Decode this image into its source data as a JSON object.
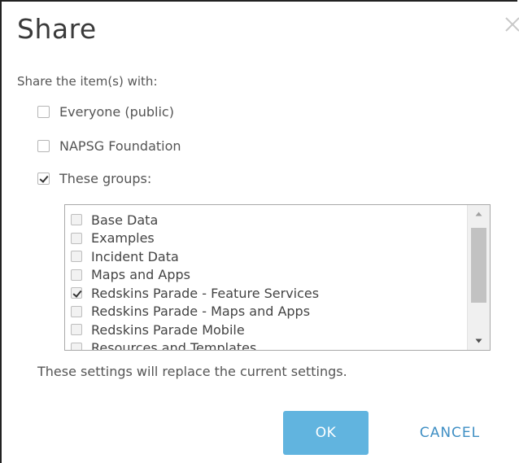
{
  "dialog": {
    "title": "Share",
    "prompt": "Share the item(s) with:",
    "options": [
      {
        "label": "Everyone (public)",
        "checked": false
      },
      {
        "label": "NAPSG Foundation",
        "checked": false
      },
      {
        "label": "These groups:",
        "checked": true
      }
    ],
    "groups": [
      {
        "label": "Base Data",
        "checked": false
      },
      {
        "label": "Examples",
        "checked": false
      },
      {
        "label": "Incident Data",
        "checked": false
      },
      {
        "label": "Maps and Apps",
        "checked": false
      },
      {
        "label": "Redskins Parade - Feature Services",
        "checked": true
      },
      {
        "label": "Redskins Parade - Maps and Apps",
        "checked": false
      },
      {
        "label": "Redskins Parade Mobile",
        "checked": false
      },
      {
        "label": "Resources and Templates",
        "checked": false
      }
    ],
    "note": "These settings will replace the current settings.",
    "ok_label": "OK",
    "cancel_label": "CANCEL"
  },
  "icons": {
    "close": "close-icon",
    "scroll_up": "arrow-up-icon",
    "scroll_down": "arrow-down-icon",
    "check": "checkmark-icon"
  },
  "colors": {
    "primary_button": "#61b4df",
    "link": "#3f8fc4",
    "text": "#555555"
  }
}
